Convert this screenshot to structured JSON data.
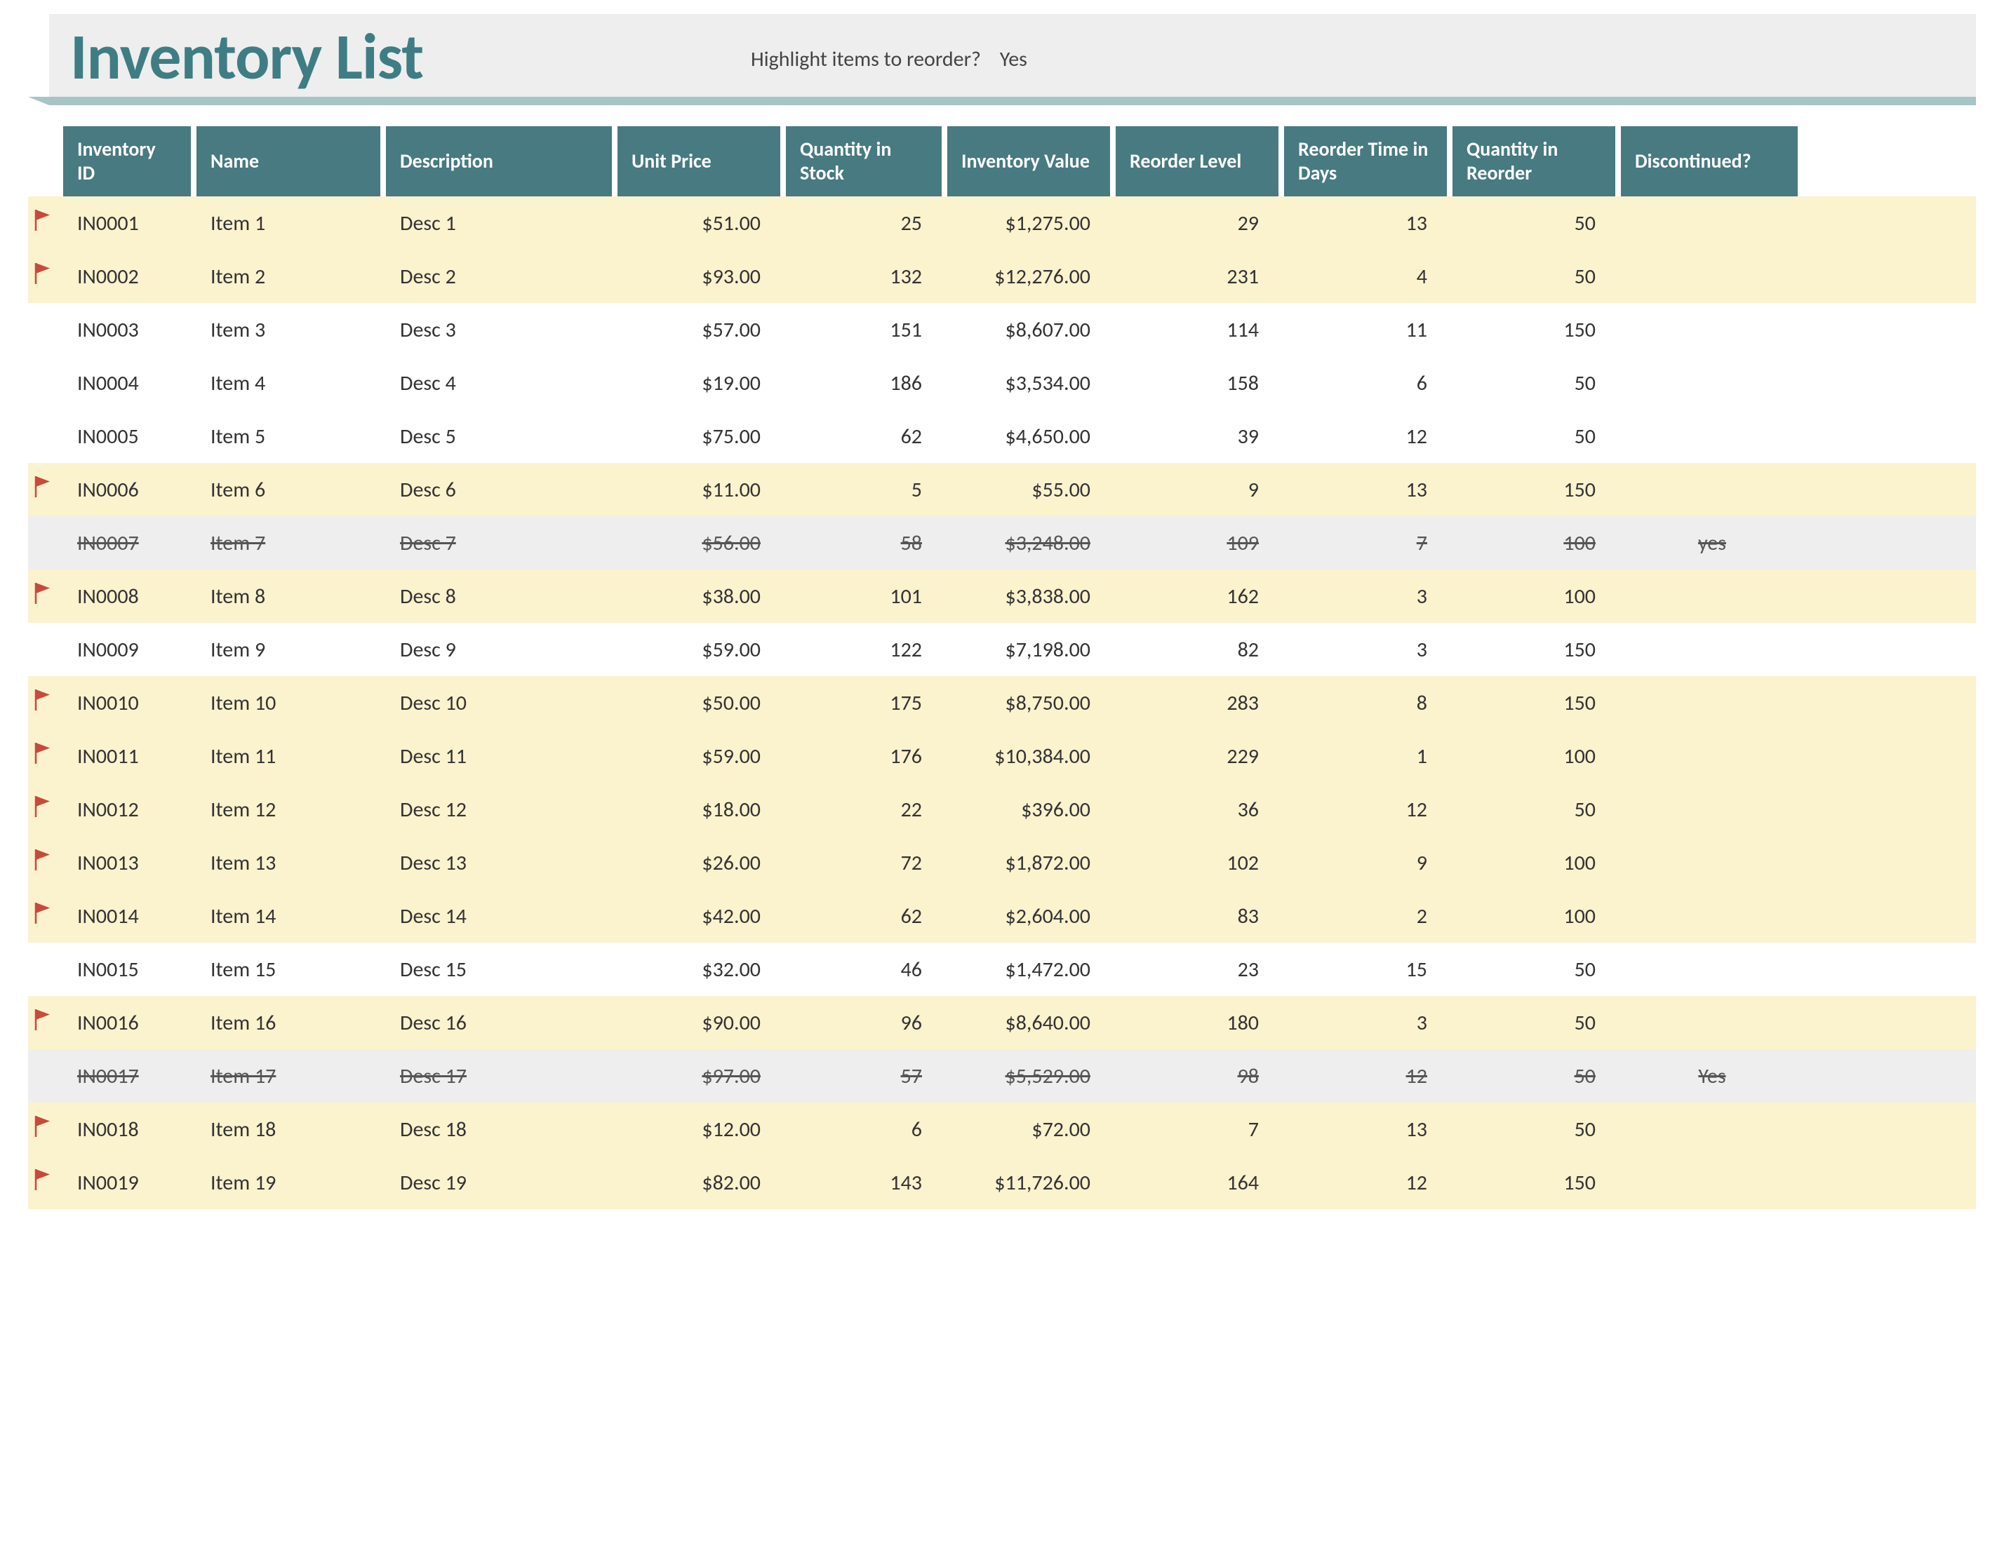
{
  "title": "Inventory List",
  "highlight_label": "Highlight items to reorder?",
  "highlight_value": "Yes",
  "columns": [
    "Inventory ID",
    "Name",
    "Description",
    "Unit Price",
    "Quantity in Stock",
    "Inventory Value",
    "Reorder Level",
    "Reorder Time in Days",
    "Quantity in Reorder",
    "Discontinued?"
  ],
  "rows": [
    {
      "flag": true,
      "id": "IN0001",
      "name": "Item 1",
      "desc": "Desc 1",
      "price": "$51.00",
      "qty": "25",
      "value": "$1,275.00",
      "reorder": "29",
      "days": "13",
      "qreorder": "50",
      "disc": "",
      "hl": true
    },
    {
      "flag": true,
      "id": "IN0002",
      "name": "Item 2",
      "desc": "Desc 2",
      "price": "$93.00",
      "qty": "132",
      "value": "$12,276.00",
      "reorder": "231",
      "days": "4",
      "qreorder": "50",
      "disc": "",
      "hl": true
    },
    {
      "flag": false,
      "id": "IN0003",
      "name": "Item 3",
      "desc": "Desc 3",
      "price": "$57.00",
      "qty": "151",
      "value": "$8,607.00",
      "reorder": "114",
      "days": "11",
      "qreorder": "150",
      "disc": "",
      "hl": false
    },
    {
      "flag": false,
      "id": "IN0004",
      "name": "Item 4",
      "desc": "Desc 4",
      "price": "$19.00",
      "qty": "186",
      "value": "$3,534.00",
      "reorder": "158",
      "days": "6",
      "qreorder": "50",
      "disc": "",
      "hl": false
    },
    {
      "flag": false,
      "id": "IN0005",
      "name": "Item 5",
      "desc": "Desc 5",
      "price": "$75.00",
      "qty": "62",
      "value": "$4,650.00",
      "reorder": "39",
      "days": "12",
      "qreorder": "50",
      "disc": "",
      "hl": false
    },
    {
      "flag": true,
      "id": "IN0006",
      "name": "Item 6",
      "desc": "Desc 6",
      "price": "$11.00",
      "qty": "5",
      "value": "$55.00",
      "reorder": "9",
      "days": "13",
      "qreorder": "150",
      "disc": "",
      "hl": true
    },
    {
      "flag": false,
      "id": "IN0007",
      "name": "Item 7",
      "desc": "Desc 7",
      "price": "$56.00",
      "qty": "58",
      "value": "$3,248.00",
      "reorder": "109",
      "days": "7",
      "qreorder": "100",
      "disc": "yes",
      "hl": false,
      "discontinued": true
    },
    {
      "flag": true,
      "id": "IN0008",
      "name": "Item 8",
      "desc": "Desc 8",
      "price": "$38.00",
      "qty": "101",
      "value": "$3,838.00",
      "reorder": "162",
      "days": "3",
      "qreorder": "100",
      "disc": "",
      "hl": true
    },
    {
      "flag": false,
      "id": "IN0009",
      "name": "Item 9",
      "desc": "Desc 9",
      "price": "$59.00",
      "qty": "122",
      "value": "$7,198.00",
      "reorder": "82",
      "days": "3",
      "qreorder": "150",
      "disc": "",
      "hl": false
    },
    {
      "flag": true,
      "id": "IN0010",
      "name": "Item 10",
      "desc": "Desc 10",
      "price": "$50.00",
      "qty": "175",
      "value": "$8,750.00",
      "reorder": "283",
      "days": "8",
      "qreorder": "150",
      "disc": "",
      "hl": true
    },
    {
      "flag": true,
      "id": "IN0011",
      "name": "Item 11",
      "desc": "Desc 11",
      "price": "$59.00",
      "qty": "176",
      "value": "$10,384.00",
      "reorder": "229",
      "days": "1",
      "qreorder": "100",
      "disc": "",
      "hl": true
    },
    {
      "flag": true,
      "id": "IN0012",
      "name": "Item 12",
      "desc": "Desc 12",
      "price": "$18.00",
      "qty": "22",
      "value": "$396.00",
      "reorder": "36",
      "days": "12",
      "qreorder": "50",
      "disc": "",
      "hl": true
    },
    {
      "flag": true,
      "id": "IN0013",
      "name": "Item 13",
      "desc": "Desc 13",
      "price": "$26.00",
      "qty": "72",
      "value": "$1,872.00",
      "reorder": "102",
      "days": "9",
      "qreorder": "100",
      "disc": "",
      "hl": true
    },
    {
      "flag": true,
      "id": "IN0014",
      "name": "Item 14",
      "desc": "Desc 14",
      "price": "$42.00",
      "qty": "62",
      "value": "$2,604.00",
      "reorder": "83",
      "days": "2",
      "qreorder": "100",
      "disc": "",
      "hl": true
    },
    {
      "flag": false,
      "id": "IN0015",
      "name": "Item 15",
      "desc": "Desc 15",
      "price": "$32.00",
      "qty": "46",
      "value": "$1,472.00",
      "reorder": "23",
      "days": "15",
      "qreorder": "50",
      "disc": "",
      "hl": false
    },
    {
      "flag": true,
      "id": "IN0016",
      "name": "Item 16",
      "desc": "Desc 16",
      "price": "$90.00",
      "qty": "96",
      "value": "$8,640.00",
      "reorder": "180",
      "days": "3",
      "qreorder": "50",
      "disc": "",
      "hl": true
    },
    {
      "flag": false,
      "id": "IN0017",
      "name": "Item 17",
      "desc": "Desc 17",
      "price": "$97.00",
      "qty": "57",
      "value": "$5,529.00",
      "reorder": "98",
      "days": "12",
      "qreorder": "50",
      "disc": "Yes",
      "hl": false,
      "discontinued": true
    },
    {
      "flag": true,
      "id": "IN0018",
      "name": "Item 18",
      "desc": "Desc 18",
      "price": "$12.00",
      "qty": "6",
      "value": "$72.00",
      "reorder": "7",
      "days": "13",
      "qreorder": "50",
      "disc": "",
      "hl": true
    },
    {
      "flag": true,
      "id": "IN0019",
      "name": "Item 19",
      "desc": "Desc 19",
      "price": "$82.00",
      "qty": "143",
      "value": "$11,726.00",
      "reorder": "164",
      "days": "12",
      "qreorder": "150",
      "disc": "",
      "hl": true
    }
  ]
}
